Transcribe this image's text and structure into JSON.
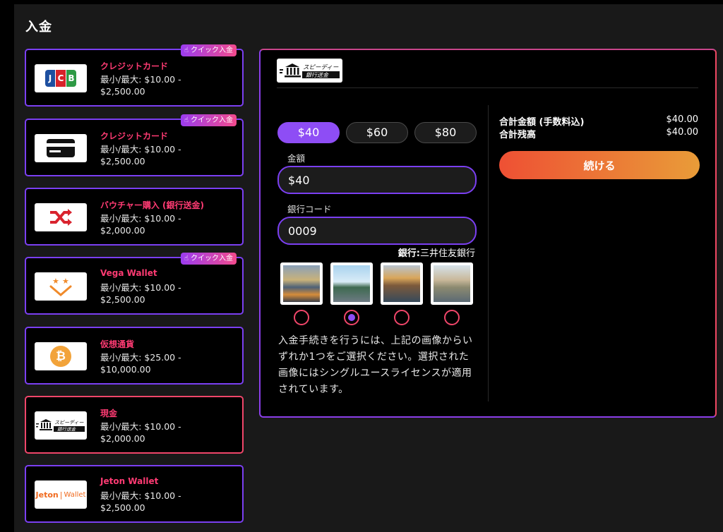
{
  "page": {
    "title": "入金"
  },
  "badge_label": "クイック入金",
  "methods": [
    {
      "name": "クレジットカード",
      "limits": "最小/最大: $10.00 - $2,500.00",
      "logo": "jcb-logo",
      "quick": true
    },
    {
      "name": "クレジットカード",
      "limits": "最小/最大: $10.00 - $2,500.00",
      "logo": "credit-card-icon",
      "quick": true
    },
    {
      "name": "バウチャー購入 (銀行送金)",
      "limits": "最小/最大: $10.00 - $2,000.00",
      "logo": "shuffle-icon",
      "quick": false
    },
    {
      "name": "Vega Wallet",
      "limits": "最小/最大: $10.00 - $2,500.00",
      "logo": "vega-wallet-logo",
      "quick": true
    },
    {
      "name": "仮想通貨",
      "limits": "最小/最大: $25.00 - $10,000.00",
      "logo": "bitcoin-icon",
      "quick": false
    },
    {
      "name": "現金",
      "limits": "最小/最大: $10.00 - $2,000.00",
      "logo": "bank-transfer-logo",
      "quick": false,
      "selected": true
    },
    {
      "name": "Jeton Wallet",
      "limits": "最小/最大: $10.00 - $2,500.00",
      "logo": "jeton-wallet-logo",
      "quick": false
    }
  ],
  "logo_text": {
    "bank_line1": "スピーディー",
    "bank_line2": "銀行送金",
    "jcb": "JCB",
    "jeton_a": "Jeton",
    "jeton_b": "Wallet"
  },
  "form": {
    "presets": [
      "$40",
      "$60",
      "$80"
    ],
    "active_preset": 0,
    "amount_label": "金額",
    "amount_value": "$40",
    "bank_code_label": "銀行コード",
    "bank_code_value": "0009",
    "bank_prefix": "銀行:",
    "bank_name": "三井住友銀行",
    "selected_image": 1,
    "notice": "入金手続きを行うには、上記の画像からいずれか1つをご選択ください。選択された画像にはシングルユースライセンスが適用されています。"
  },
  "summary": {
    "total_fee_label": "合計金額 (手数料込)",
    "total_fee_value": "$40.00",
    "total_balance_label": "合計残高",
    "total_balance_value": "$40.00",
    "continue_label": "続ける"
  },
  "colors": {
    "accent_purple": "#8e4df5",
    "accent_pink": "#ff3b73",
    "continue_gradient_start": "#ee5034",
    "continue_gradient_end": "#e99c38"
  }
}
